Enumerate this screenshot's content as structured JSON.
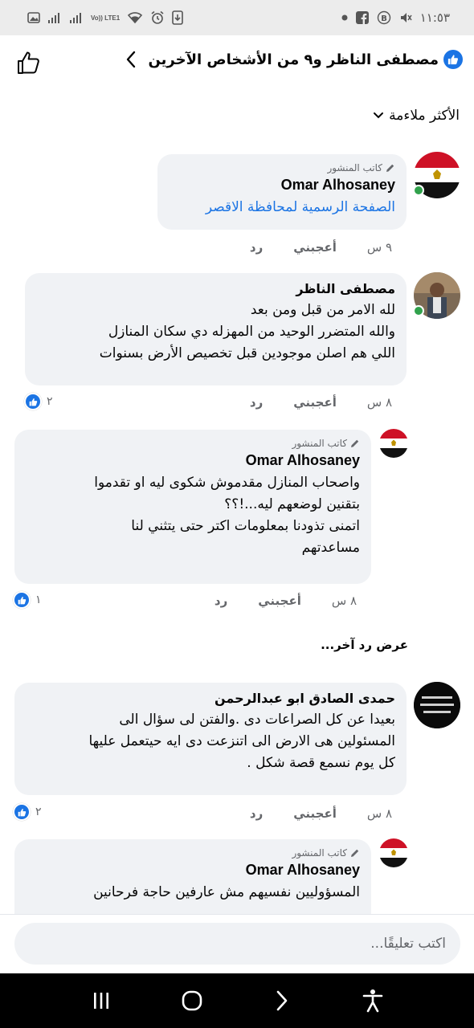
{
  "status_bar": {
    "time": "١١:٥٣",
    "left_icons": [
      "gallery-icon",
      "signal-icon",
      "signal-icon",
      "volte-icon",
      "wifi-icon",
      "alarm-icon",
      "save-icon"
    ],
    "network_label": "Vo)) LTE1",
    "right_icons": [
      "dot-icon",
      "facebook-icon",
      "b-icon",
      "mute-icon"
    ]
  },
  "header": {
    "title": "مصطفى الناظر و٩ من الأشخاص الآخرين"
  },
  "sort": {
    "label": "الأكثر ملاءمة"
  },
  "comments": [
    {
      "author_tag": "كاتب المنشور",
      "author": "Omar Alhosaney",
      "text": "الصفحة الرسمية لمحافظة الاقصر",
      "time": "٩ س",
      "like": "أعجبني",
      "reply": "رد"
    },
    {
      "author": "مصطفى الناظر",
      "text": "لله الامر من قبل ومن بعد\nوالله المتضرر الوحيد من المهزله دي سكان المنازل\nاللي هم اصلن موجودين قبل تخصيص الأرض بسنوات",
      "time": "٨ س",
      "like": "أعجبني",
      "reply": "رد",
      "reactions": "٢"
    },
    {
      "author_tag": "كاتب المنشور",
      "author": "Omar Alhosaney",
      "text": "واصحاب المنازل مقدموش شكوى ليه او تقدموا\nبتقنين لوضعهم ليه...!؟؟\nاتمنى تذودنا بمعلومات اكتر حتى يتثني لنا\nمساعدتهم",
      "time": "٨ س",
      "like": "أعجبني",
      "reply": "رد",
      "reactions": "١"
    },
    {
      "author": "حمدى الصادق ابو عبدالرحمن",
      "text": "بعيدا عن كل الصراعات دى .والفتن لى سؤال الى\nالمسئولين هى الارض الى اتنزعت دى ايه حيتعمل عليها\nكل يوم نسمع قصة شكل .",
      "time": "٨ س",
      "like": "أعجبني",
      "reply": "رد",
      "reactions": "٢",
      "avatar_text": "لا تحسبن الله غافلا عما يعمل الظالمون"
    },
    {
      "author_tag": "كاتب المنشور",
      "author": "Omar Alhosaney",
      "text": "المسؤوليين نفسيهم مش عارفين حاجة فرحانين"
    }
  ],
  "more_replies": "عرض رد آخر...",
  "comment_input": {
    "placeholder": "اكتب تعليقًا..."
  },
  "nav_bar": {
    "items": [
      "recents-icon",
      "home-icon",
      "back-icon",
      "accessibility-icon"
    ]
  },
  "colors": {
    "accent": "#1b74e4",
    "bubble": "#f0f2f5",
    "online": "#31a24c"
  }
}
